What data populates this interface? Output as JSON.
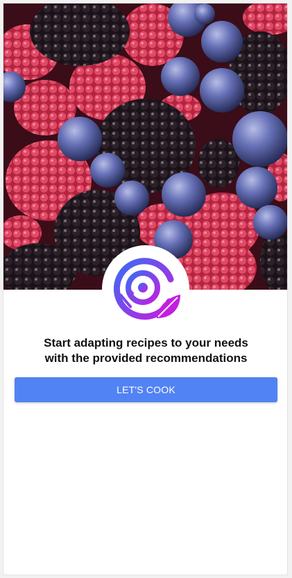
{
  "hero": {
    "image": "mixed-berries-photo"
  },
  "logo": {
    "icon": "recipe-app-logo-icon",
    "gradient_start": "#3a6cf3",
    "gradient_end": "#c41ee0"
  },
  "onboarding": {
    "line1": "Start adapting recipes to your needs",
    "line2": "with the provided recommendations"
  },
  "cta": {
    "label": "LET'S COOK",
    "color": "#5283f4"
  }
}
